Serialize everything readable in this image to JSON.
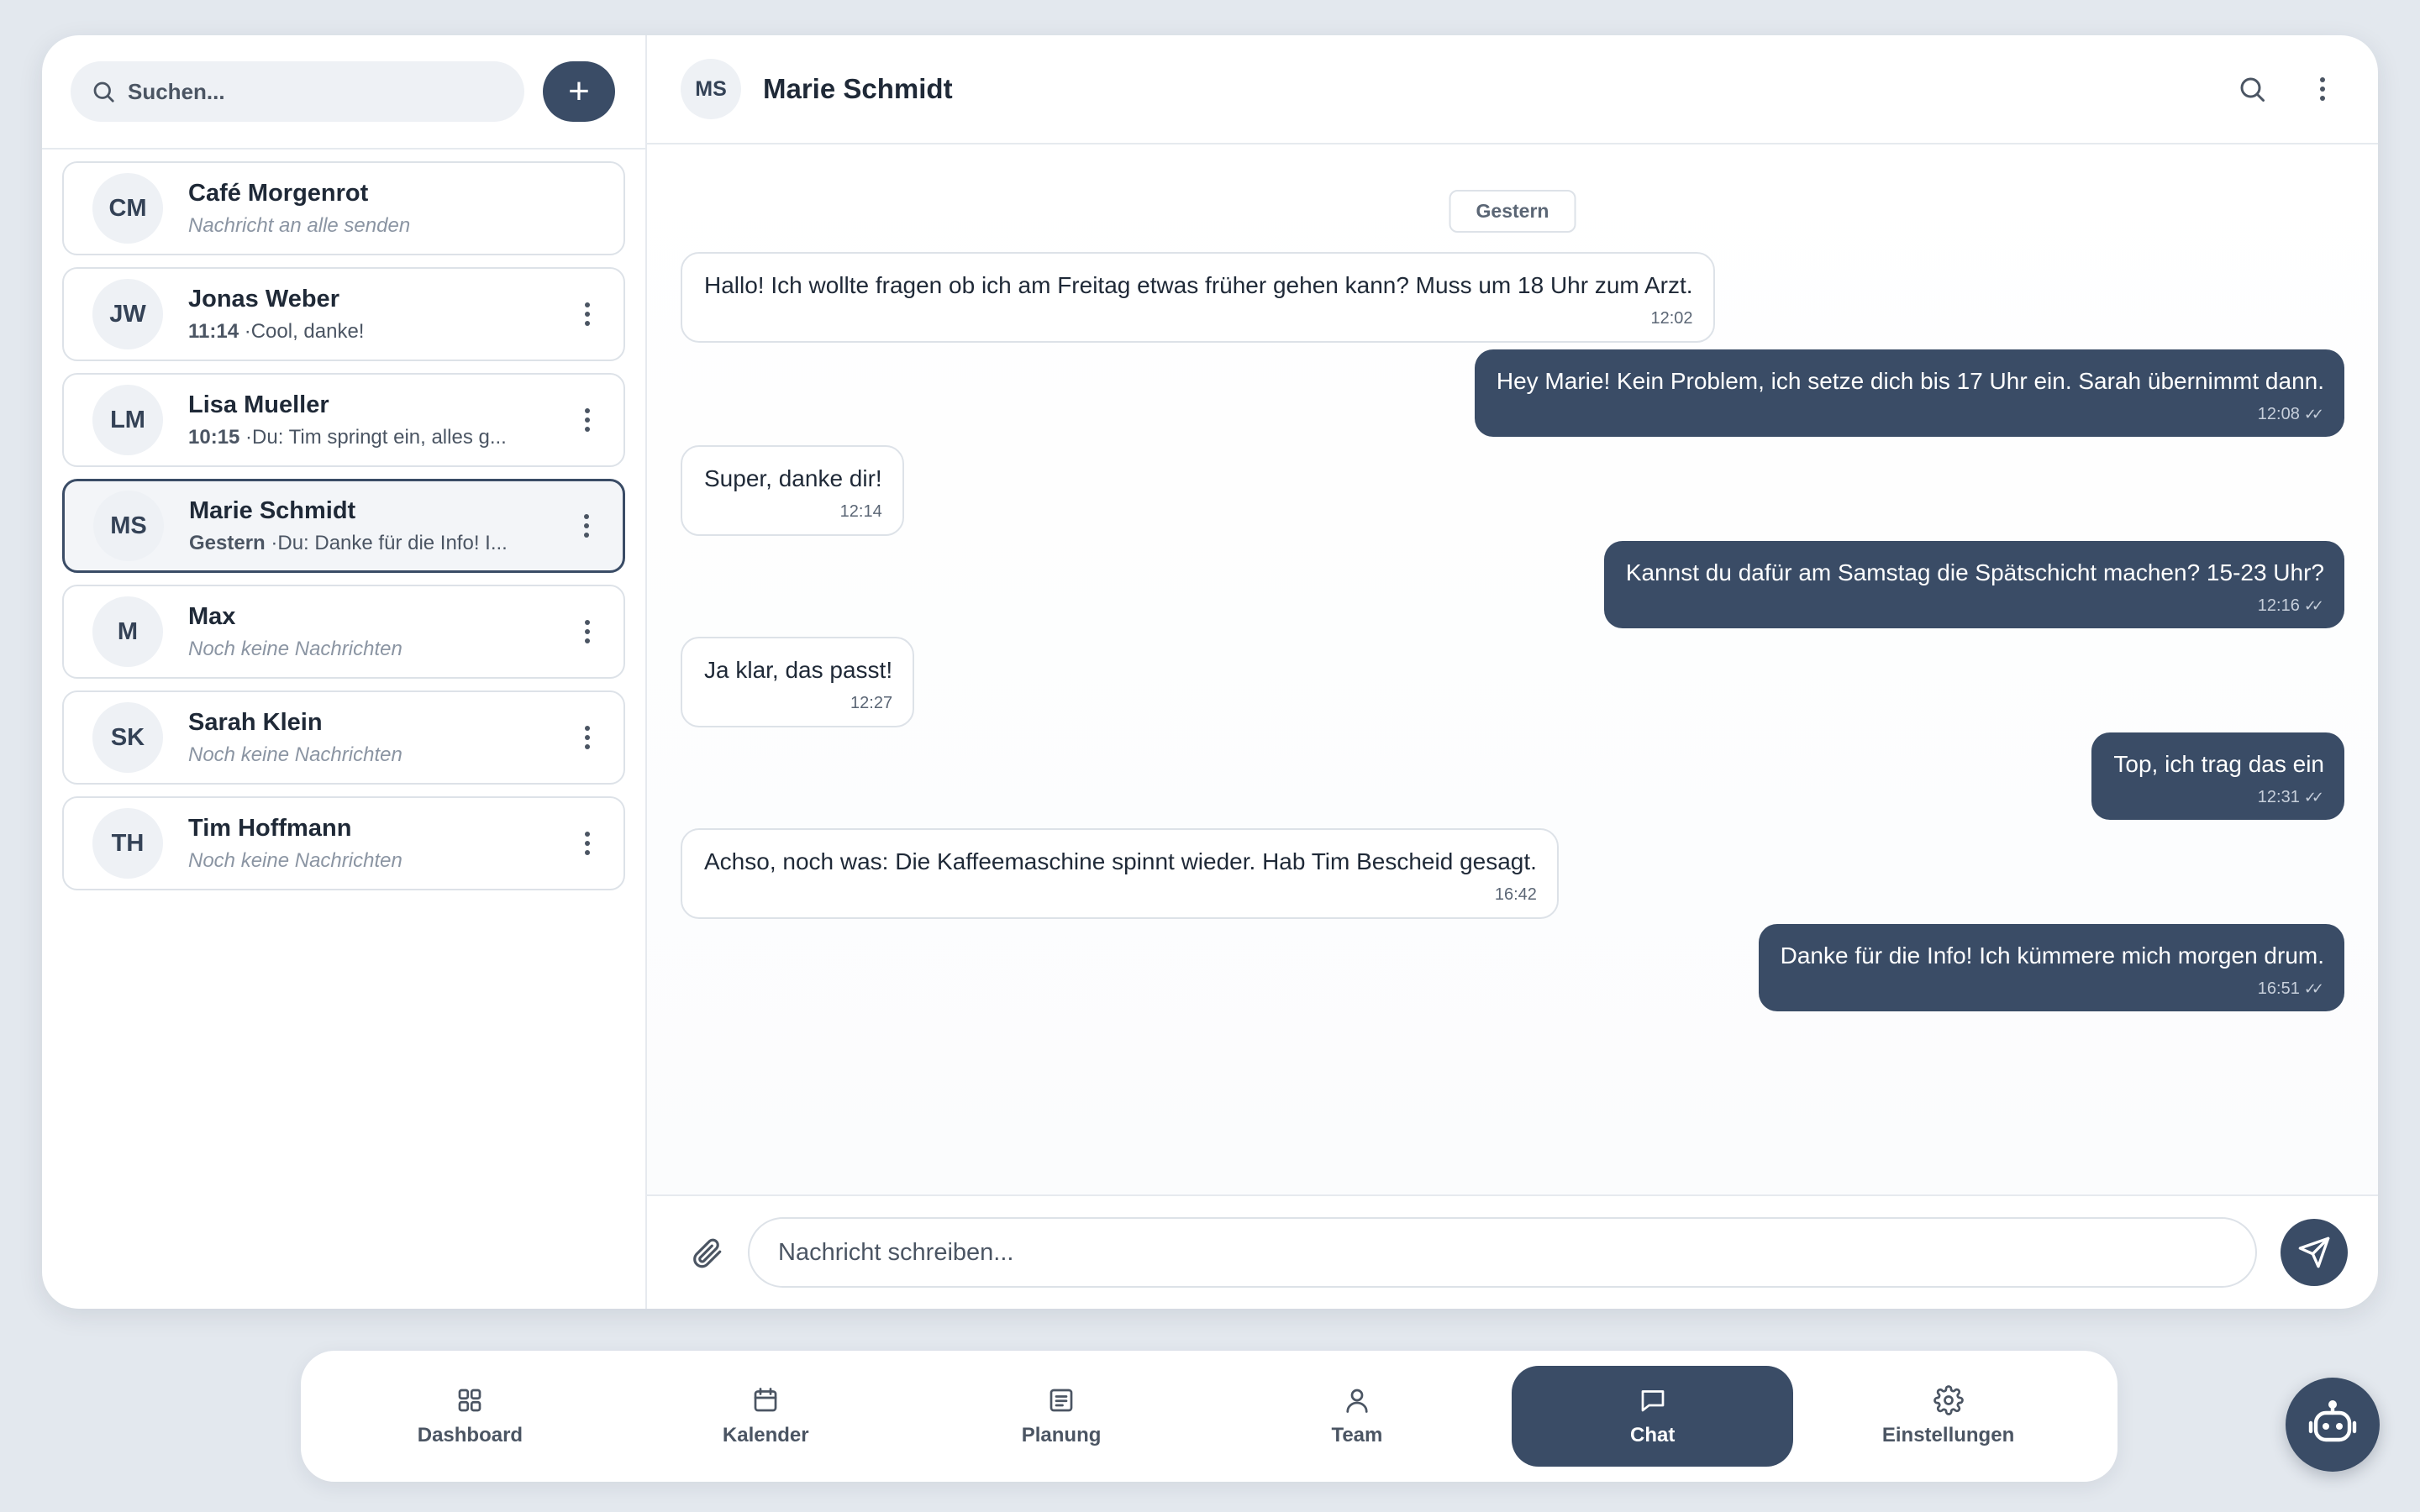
{
  "sidebar": {
    "search_placeholder": "Suchen...",
    "add_label": "+",
    "conversations": [
      {
        "initials": "CM",
        "name": "Café Morgenrot",
        "time": "",
        "preview": "Nachricht an alle senden",
        "empty": true
      },
      {
        "initials": "JW",
        "name": "Jonas Weber",
        "time": "11:14",
        "preview": " ·Cool, danke!",
        "empty": false
      },
      {
        "initials": "LM",
        "name": "Lisa Mueller",
        "time": "10:15",
        "preview": " ·Du: Tim springt ein, alles g...",
        "empty": false
      },
      {
        "initials": "MS",
        "name": "Marie Schmidt",
        "time": "Gestern",
        "preview": " ·Du: Danke für die Info! I...",
        "empty": false,
        "active": true
      },
      {
        "initials": "M",
        "name": "Max",
        "time": "",
        "preview": "Noch keine Nachrichten",
        "empty": true
      },
      {
        "initials": "SK",
        "name": "Sarah Klein",
        "time": "",
        "preview": "Noch keine Nachrichten",
        "empty": true
      },
      {
        "initials": "TH",
        "name": "Tim Hoffmann",
        "time": "",
        "preview": "Noch keine Nachrichten",
        "empty": true
      }
    ]
  },
  "chat": {
    "initials": "MS",
    "title": "Marie Schmidt",
    "date_chip": "Gestern",
    "messages": [
      {
        "dir": "in",
        "text": "Hallo! Ich wollte fragen ob ich am Freitag etwas früher gehen kann? Muss um 18 Uhr zum Arzt.",
        "time": "12:02"
      },
      {
        "dir": "out",
        "text": "Hey Marie! Kein Problem, ich setze dich bis 17 Uhr ein. Sarah übernimmt dann.",
        "time": "12:08"
      },
      {
        "dir": "in",
        "text": "Super, danke dir!",
        "time": "12:14"
      },
      {
        "dir": "out",
        "text": "Kannst du dafür am Samstag die Spätschicht machen? 15-23 Uhr?",
        "time": "12:16"
      },
      {
        "dir": "in",
        "text": "Ja klar, das passt!",
        "time": "12:27"
      },
      {
        "dir": "out",
        "text": "Top, ich trag das ein",
        "time": "12:31"
      },
      {
        "dir": "in",
        "text": "Achso, noch was: Die Kaffeemaschine spinnt wieder. Hab Tim Bescheid gesagt.",
        "time": "16:42"
      },
      {
        "dir": "out",
        "text": "Danke für die Info! Ich kümmere mich morgen drum.",
        "time": "16:51"
      }
    ],
    "composer_placeholder": "Nachricht schreiben..."
  },
  "nav": {
    "items": [
      {
        "label": "Dashboard",
        "icon": "grid-icon"
      },
      {
        "label": "Kalender",
        "icon": "calendar-icon"
      },
      {
        "label": "Planung",
        "icon": "document-icon"
      },
      {
        "label": "Team",
        "icon": "user-icon"
      },
      {
        "label": "Chat",
        "icon": "chat-bubble-icon",
        "active": true
      },
      {
        "label": "Einstellungen",
        "icon": "gear-icon"
      }
    ]
  },
  "theme": {
    "accent": "#3a4c66",
    "background": "#e3e8ee"
  }
}
